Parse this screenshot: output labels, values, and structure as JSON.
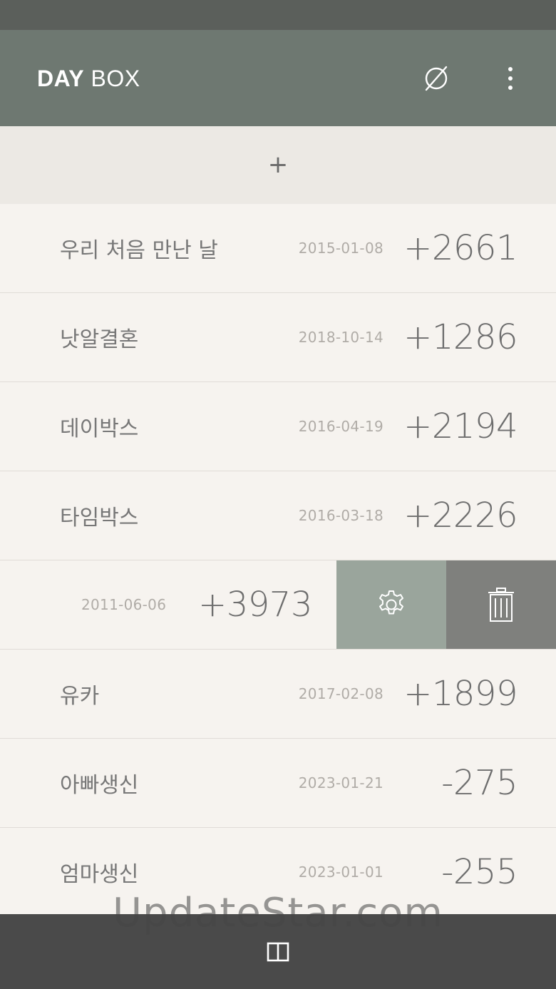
{
  "app": {
    "title_part1": "DAY",
    "title_part2": " BOX"
  },
  "toolbar": {
    "sort_icon": "empty-set-icon",
    "more_icon": "more-vert-icon"
  },
  "add_row": {
    "label": "+"
  },
  "items": [
    {
      "title": "우리 처음 만난 날",
      "date": "2015-01-08",
      "count": "+2661"
    },
    {
      "title": "낫알결혼",
      "date": "2018-10-14",
      "count": "+1286"
    },
    {
      "title": "데이박스",
      "date": "2016-04-19",
      "count": "+2194"
    },
    {
      "title": "타임박스",
      "date": "2016-03-18",
      "count": "+2226"
    },
    {
      "title": "",
      "date": "2011-06-06",
      "count": "+3973",
      "swiped": true
    },
    {
      "title": "유카",
      "date": "2017-02-08",
      "count": "+1899"
    },
    {
      "title": "아빠생신",
      "date": "2023-01-21",
      "count": "-275"
    },
    {
      "title": "엄마생신",
      "date": "2023-01-01",
      "count": "-255"
    }
  ],
  "swipe_actions": {
    "settings_icon": "gear-icon",
    "delete_icon": "trash-icon"
  },
  "watermark": {
    "text": "UpdateStar.com"
  },
  "bottom_bar": {
    "icon": "columns-icon"
  },
  "colors": {
    "app_bar": "#6e7871",
    "status_bar": "#5b5f5b",
    "settings_action": "#9aa59c",
    "delete_action": "#7f807d",
    "bottom_bar": "#4a4a4a"
  }
}
